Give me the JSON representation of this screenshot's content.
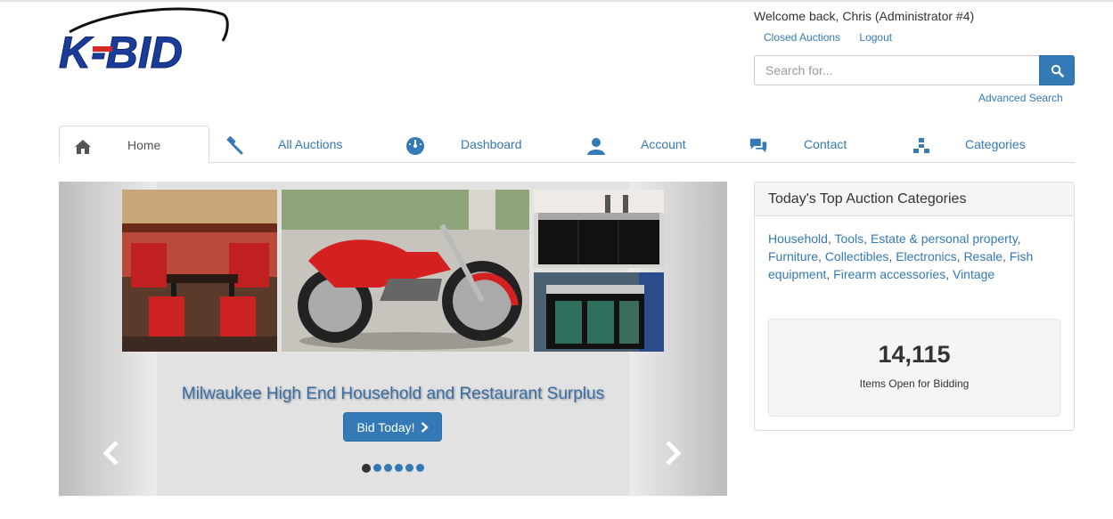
{
  "header": {
    "logo_text": "K-BID",
    "welcome": "Welcome back, Chris (Administrator #4)",
    "links": [
      "Closed Auctions",
      "Logout"
    ],
    "search": {
      "placeholder": "Search for..."
    },
    "advanced_search": "Advanced Search"
  },
  "nav": {
    "items": [
      {
        "label": "Home",
        "icon": "home-icon",
        "active": true
      },
      {
        "label": "All Auctions",
        "icon": "gavel-icon"
      },
      {
        "label": "Dashboard",
        "icon": "dashboard-icon"
      },
      {
        "label": "Account",
        "icon": "user-icon"
      },
      {
        "label": "Contact",
        "icon": "comments-icon"
      },
      {
        "label": "Categories",
        "icon": "sitemap-icon"
      }
    ]
  },
  "carousel": {
    "caption": "Milwaukee High End Household and Restaurant Surplus",
    "button_label": "Bid Today!",
    "slides": 6,
    "active_slide": 1
  },
  "top_categories": {
    "title": "Today's Top Auction Categories",
    "categories": [
      "Household",
      "Tools",
      "Estate & personal property",
      "Resale",
      "Furniture",
      "Collectibles",
      "Electronics",
      "Resale",
      "Fish equipment",
      "Firearm accessories",
      "Vintage"
    ],
    "items_open_count": "14,115",
    "items_open_label": "Items Open for Bidding"
  },
  "colors": {
    "brand_blue": "#337ab7",
    "logo_blue": "#1a3d9c",
    "logo_red": "#d42a2a"
  }
}
